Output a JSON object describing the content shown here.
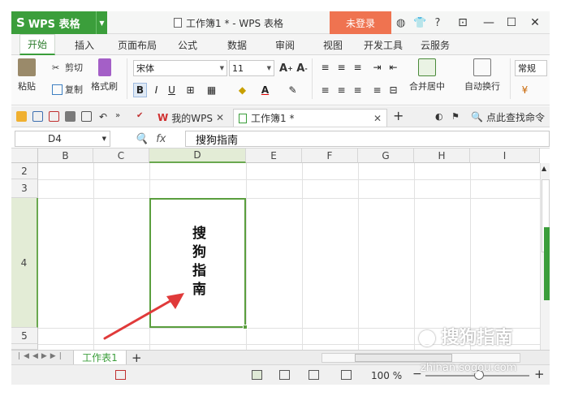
{
  "app": {
    "name": "WPS 表格"
  },
  "title": "工作簿1 * - WPS 表格",
  "login_label": "未登录",
  "window_controls": {
    "help": "?",
    "minimize": "—",
    "maximize": "☐",
    "close": "✕"
  },
  "menu_tabs": [
    "开始",
    "插入",
    "页面布局",
    "公式",
    "数据",
    "审阅",
    "视图",
    "开发工具",
    "云服务"
  ],
  "ribbon": {
    "paste": "粘贴",
    "cut": "剪切",
    "copy": "复制",
    "format_painter": "格式刷",
    "font_name": "宋体",
    "font_size": "11",
    "bold": "B",
    "italic": "I",
    "underline": "U",
    "merge_center": "合并居中",
    "wrap_text": "自动换行",
    "number_format": "常规"
  },
  "doc_tabs": {
    "my_wps": "我的WPS",
    "workbook": "工作簿1 *",
    "find_command": "点此查找命令"
  },
  "formula_bar": {
    "name_box": "D4",
    "fx": "fx",
    "value": "搜狗指南"
  },
  "columns": [
    "B",
    "C",
    "D",
    "E",
    "F",
    "G",
    "H",
    "I"
  ],
  "rows": [
    "2",
    "3",
    "4",
    "5"
  ],
  "active_cell": {
    "text": "搜狗指南"
  },
  "sheet_tabs": [
    "工作表1"
  ],
  "status": {
    "zoom": "100 %"
  },
  "watermark": {
    "text": "搜狗指南",
    "url": "zhinan.sogou.com"
  },
  "colors": {
    "accent": "#3b9e3b",
    "login": "#ef7350",
    "arrow": "#e03a3a"
  }
}
